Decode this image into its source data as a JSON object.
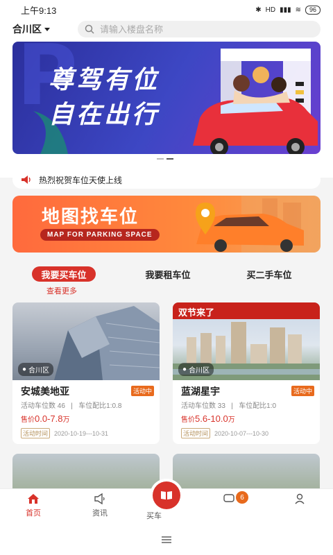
{
  "status": {
    "time": "上午9:13",
    "battery": "96",
    "signal_label": "HD"
  },
  "header": {
    "city": "合川区",
    "search_placeholder": "请输入楼盘名称"
  },
  "banner": {
    "line1": "尊驾有位",
    "line2": "自在出行"
  },
  "notice": {
    "text": "热烈祝贺车位天使上线"
  },
  "map_banner": {
    "title": "地图找车位",
    "subtitle": "MAP FOR PARKING SPACE"
  },
  "tabs": [
    "我要买车位",
    "我要租车位",
    "买二手车位"
  ],
  "more_link": "查看更多",
  "listings": [
    {
      "name": "安城美地亚",
      "location": "合川区",
      "status": "活动中",
      "spaces_label": "活动车位数 46",
      "ratio_label": "车位配比1:0.8",
      "price_label": "售价",
      "price": "0.0-7.8",
      "price_unit": "万",
      "time_label": "活动时间",
      "time": "2020-10-19---10-31"
    },
    {
      "name": "蓝湖星宇",
      "location": "合川区",
      "promo": "双节来了",
      "status": "活动中",
      "spaces_label": "活动车位数 33",
      "ratio_label": "车位配比1:0",
      "price_label": "售价",
      "price": "5.6-10.0",
      "price_unit": "万",
      "time_label": "活动时间",
      "time": "2020-10-07---10-30"
    }
  ],
  "bottom_nav": [
    {
      "label": "首页",
      "icon": "home-icon",
      "active": true
    },
    {
      "label": "资讯",
      "icon": "megaphone-icon",
      "active": false
    },
    {
      "label": "买车",
      "icon": "book-icon",
      "active": false
    },
    {
      "label": "",
      "icon": "message-icon",
      "active": false,
      "badge": "6"
    },
    {
      "label": "",
      "icon": "user-icon",
      "active": false
    }
  ],
  "colors": {
    "accent": "#d8322a",
    "orange": "#e86a1d"
  }
}
